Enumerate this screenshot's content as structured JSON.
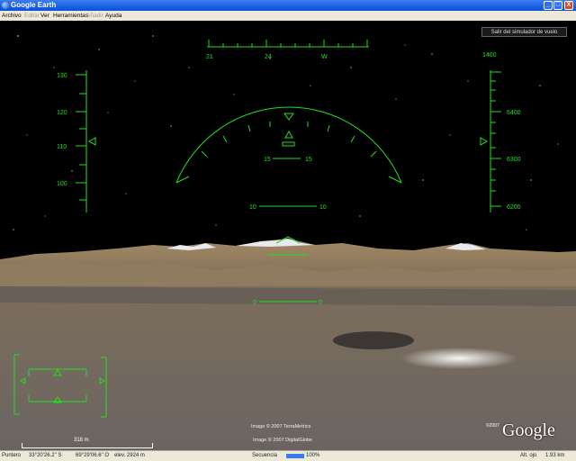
{
  "window": {
    "title": "Google Earth",
    "minimize": "_",
    "maximize": "□",
    "close": "X"
  },
  "menu": [
    {
      "label": "Archivo",
      "enabled": true
    },
    {
      "label": "Editar",
      "enabled": false
    },
    {
      "label": "Ver",
      "enabled": true
    },
    {
      "label": "Herramientas",
      "enabled": true
    },
    {
      "label": "Añadir",
      "enabled": false
    },
    {
      "label": "Ayuda",
      "enabled": true
    }
  ],
  "exit_button": "Salir del simulador de vuelo",
  "hud": {
    "color": "#21e021",
    "heading_labels": [
      "21",
      "24",
      "W"
    ],
    "speed_labels": [
      "130",
      "120",
      "110",
      "100"
    ],
    "altitude_top": "1400",
    "altitude_labels": [
      "6400",
      "6300",
      "6200"
    ],
    "pitch_15_left": "15",
    "pitch_15_right": "15",
    "pitch_10_left": "10",
    "pitch_10_right": "10",
    "pitch_0_left": "0",
    "pitch_0_right": "0"
  },
  "attribution": {
    "line1": "Image © 2007 TerraMetrics",
    "line2": "Image © 2007 DigitalGlobe",
    "logo_copyright": "©2007",
    "logo": "Google"
  },
  "scale": {
    "label": "318 m"
  },
  "status": {
    "pointer_label": "Puntero",
    "lat": "33°20'26.2\" S",
    "lon": "69°29'06.6\" O",
    "elev": "elev. 2924 m",
    "stream_label": "Secuencia",
    "stream_value": "100%",
    "eye_label": "Alt. ojo",
    "eye_value": "1.93 km"
  }
}
